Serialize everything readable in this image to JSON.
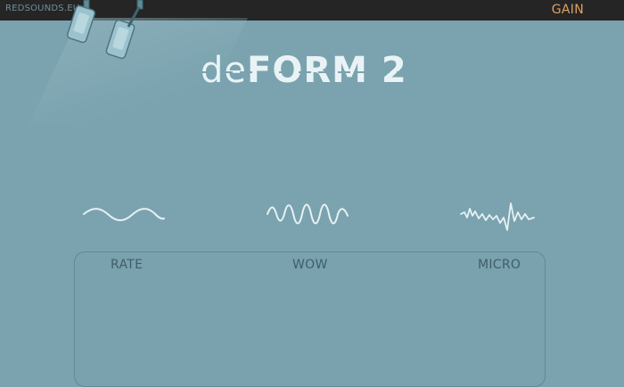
{
  "header": {
    "brand": "REDSOUNDS.EU",
    "gain_label": "GAIN"
  },
  "logo": {
    "prefix": "de",
    "main": "FORM 2"
  },
  "controls": [
    {
      "label": "RATE"
    },
    {
      "label": "WOW"
    },
    {
      "label": "MICRO"
    }
  ],
  "colors": {
    "background": "#7aa3af",
    "topbar": "#252525",
    "accent": "#e0a160",
    "wave": "#e7f1f3",
    "label": "#3f5e68"
  }
}
